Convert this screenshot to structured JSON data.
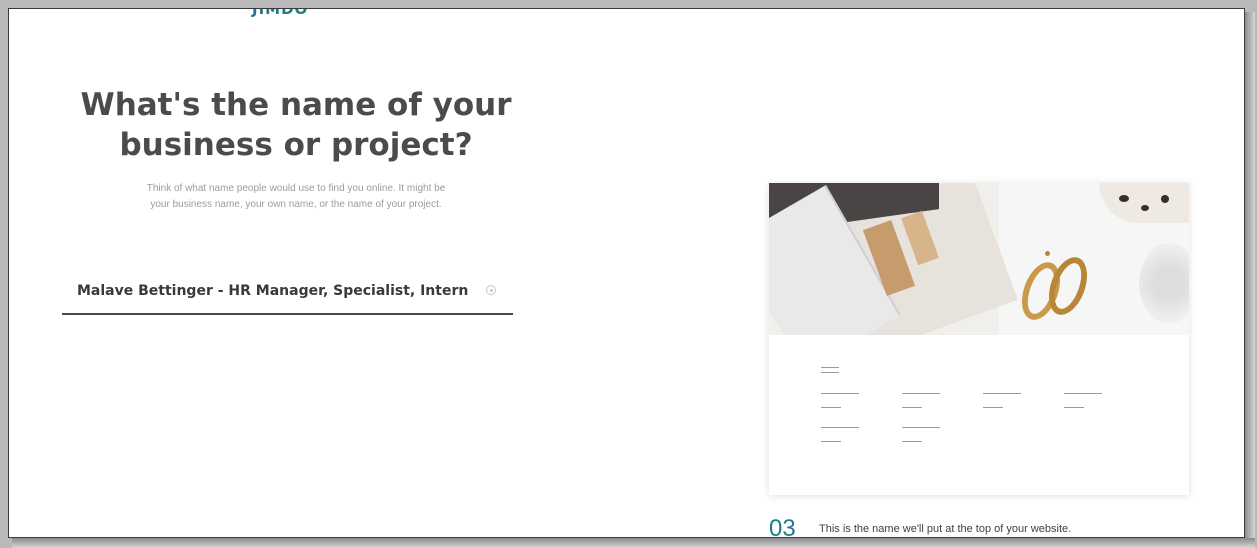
{
  "brand": {
    "logo_text": "JIMDO",
    "accent_color": "#1f7a8c"
  },
  "main": {
    "heading_line1": "What's the name of your",
    "heading_line2": "business or project?",
    "subtext_line1": "Think of what name people would use to find you online. It might be",
    "subtext_line2": "your business name, your own name, or the name of your project."
  },
  "name_field": {
    "value": "Malave Bettinger - HR Manager, Specialist, Intern",
    "clear_icon": "clear-icon"
  },
  "preview": {
    "step_number": "03",
    "caption": "This is the name we'll put at the top of your website."
  }
}
